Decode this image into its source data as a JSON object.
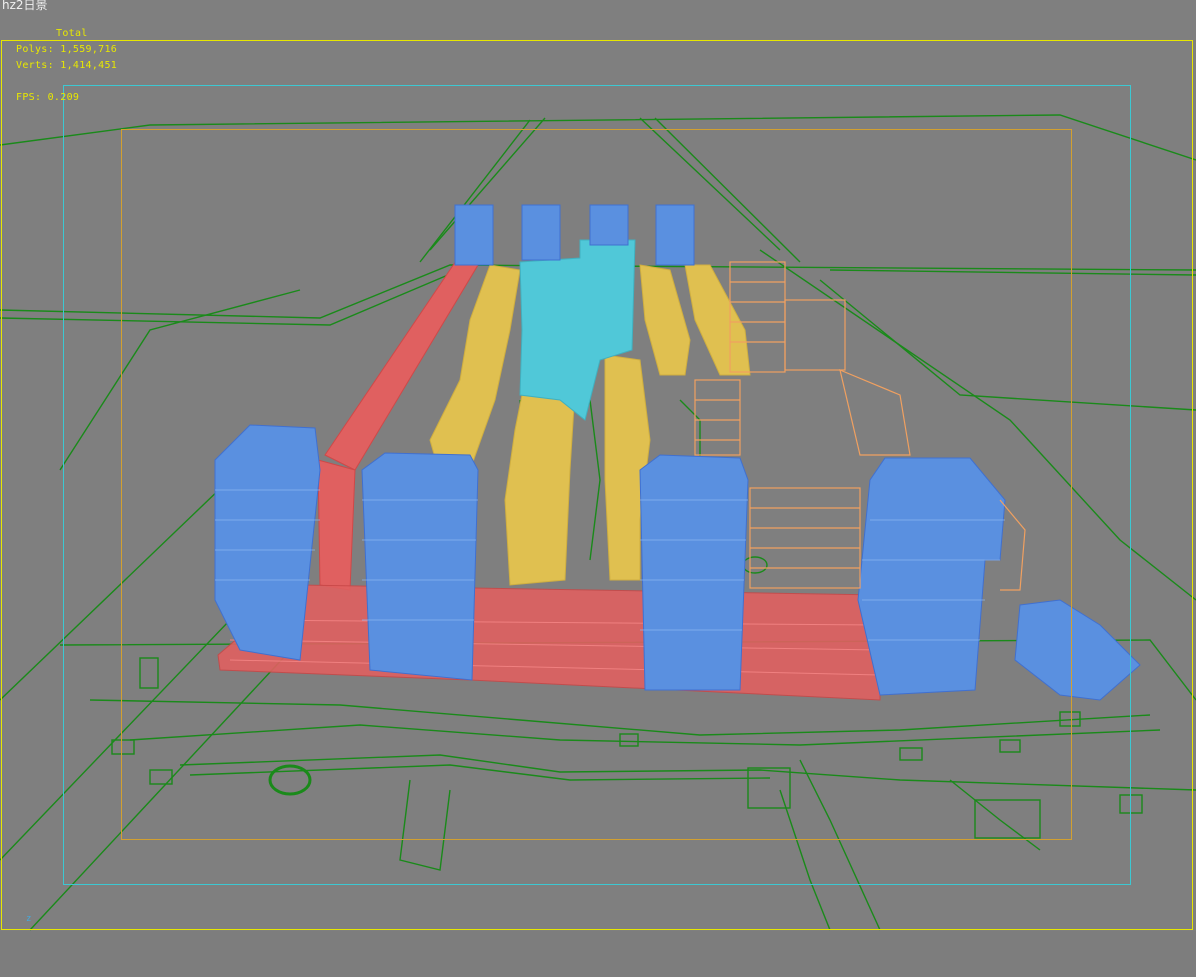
{
  "viewport": {
    "label": "hz2日景",
    "stats_header": "Total",
    "polys": "Polys: 1,559,716",
    "verts": "Verts: 1,414,451",
    "fps": "FPS:  0.209",
    "axis_label": "z"
  },
  "colors": {
    "background": "#7f7f7f",
    "wire_green": "#1a8a1a",
    "tower_blue": "#5a90e0",
    "slab_yellow": "#e0c050",
    "slab_red": "#e06060",
    "center_cyan": "#50c8d8",
    "orange_wire": "#f0a060",
    "stats_yellow": "#e8e800"
  }
}
